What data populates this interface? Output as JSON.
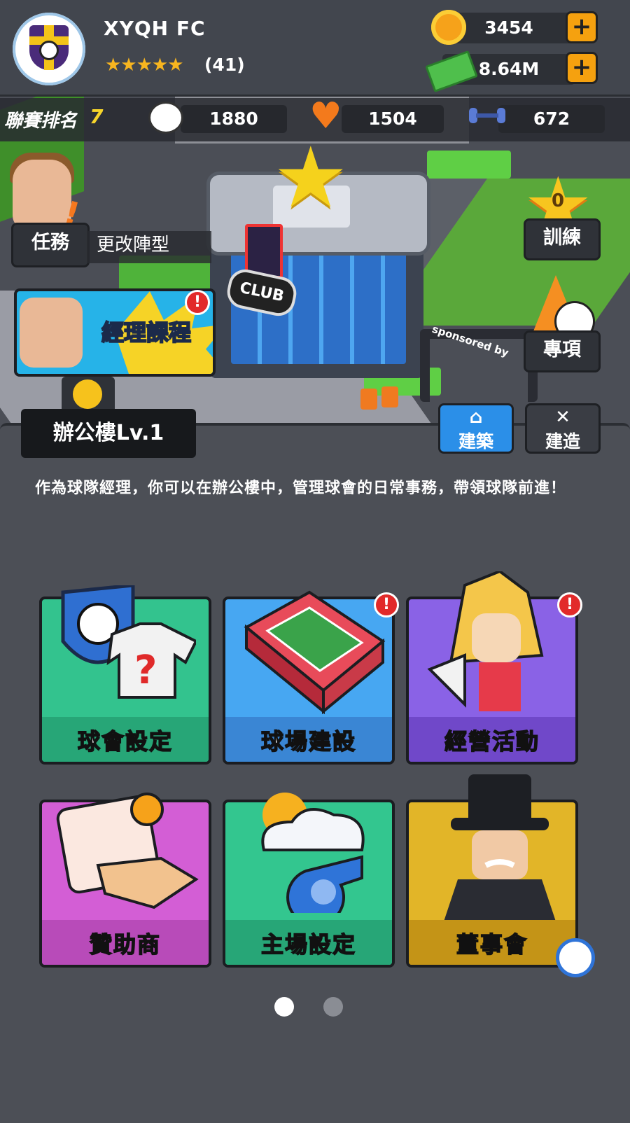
{
  "header": {
    "team_name": "XYQH FC",
    "stars": "★★★★★",
    "rating_count": "(41)",
    "coins": "3454",
    "cash": "8.64M"
  },
  "stats": {
    "league_label": "聯賽排名",
    "league_rank": "7",
    "fans": "1880",
    "hearts": "1504",
    "strength": "672"
  },
  "map": {
    "club_sign": "CLUB",
    "sponsor_sign": "sponsored by"
  },
  "side_left": {
    "mission_label": "任務",
    "formation_label": "更改陣型",
    "course_label": "經理課程",
    "course_badge": "!"
  },
  "side_right": {
    "training_label": "訓練",
    "training_count": "0",
    "special_label": "專項"
  },
  "panel": {
    "title": "辦公樓Lv.1",
    "tabs": [
      {
        "label": "建築",
        "icon": "house-icon",
        "active": true
      },
      {
        "label": "建造",
        "icon": "tools-icon",
        "active": false
      }
    ],
    "description": "作為球隊經理，你可以在辦公樓中，管理球會的日常事務，帶領球隊前進！",
    "cards": [
      {
        "label": "球會設定",
        "color": "#33c38e",
        "badge": ""
      },
      {
        "label": "球場建設",
        "color": "#47a7f2",
        "badge": "!"
      },
      {
        "label": "經營活動",
        "color": "#8a62e6",
        "badge": "!"
      },
      {
        "label": "贊助商",
        "color": "#d35ed5",
        "badge": ""
      },
      {
        "label": "主場設定",
        "color": "#33c68f",
        "badge": ""
      },
      {
        "label": "董事會",
        "color": "#e2b528",
        "badge": ""
      }
    ],
    "page_indicator": {
      "current": 1,
      "total": 2
    }
  },
  "colors": {
    "accent_blue": "#2b8fe8",
    "coin_orange": "#f5a10f",
    "badge_red": "#e22a2a",
    "league_rank_yellow": "#f7d52b"
  }
}
